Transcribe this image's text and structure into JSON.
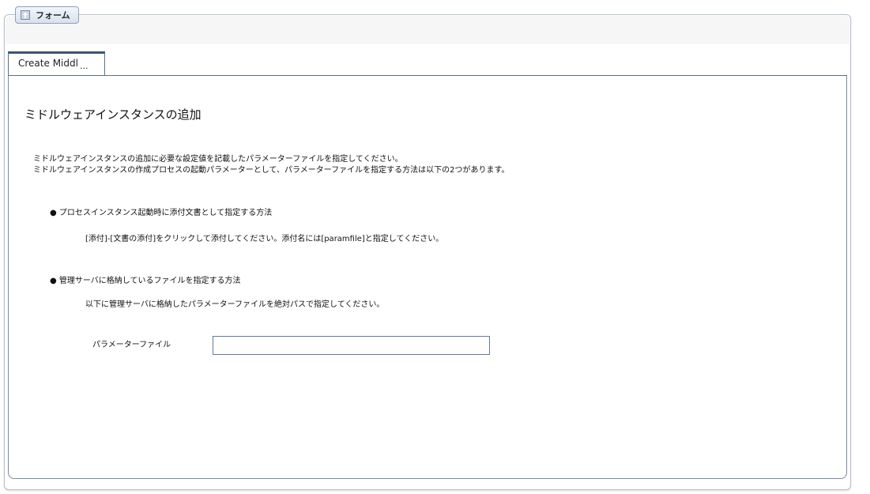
{
  "frame": {
    "legend_label": "フォーム",
    "legend_icon": "collapse-up-icon"
  },
  "tabs": [
    {
      "label": "Create Middle",
      "overflow": "...",
      "selected": true
    }
  ],
  "form": {
    "title": "ミドルウェアインスタンスの追加",
    "description_lines": [
      "ミドルウェアインスタンスの追加に必要な設定値を記載したパラメーターファイルを指定してください。",
      "ミドルウェアインスタンスの作成プロセスの起動パラメーターとして、パラメーターファイルを指定する方法は以下の2つがあります。"
    ],
    "methods": [
      {
        "heading": "● プロセスインスタンス起動時に添付文書として指定する方法",
        "detail": "[添付]-[文書の添付]をクリックして添付してください。添付名には[paramfile]と指定してください。"
      },
      {
        "heading": "● 管理サーバに格納しているファイルを指定する方法",
        "detail": "以下に管理サーバに格納したパラメーターファイルを絶対パスで指定してください。"
      }
    ],
    "param_field": {
      "label": "パラメーターファイル",
      "value": ""
    }
  },
  "colors": {
    "border": "#b7c0cc",
    "tab_accent": "#3d5479",
    "input_border": "#5f7aa3"
  }
}
